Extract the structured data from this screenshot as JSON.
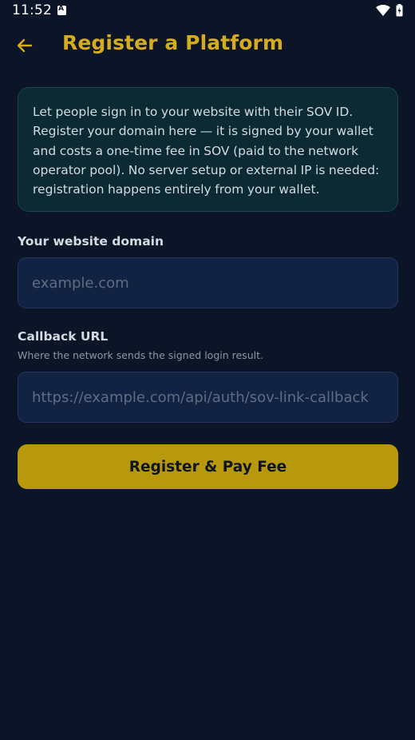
{
  "status_bar": {
    "time": "11:52",
    "icons": [
      "app-notification-icon",
      "wifi-icon",
      "battery-icon"
    ]
  },
  "header": {
    "back_icon": "arrow-left-icon",
    "title": "Register a Platform"
  },
  "info_card": {
    "text": "Let people sign in to your website with their SOV ID. Register your domain here — it is signed by your wallet and costs a one-time fee in SOV (paid to the network operator pool). No server setup or external IP is needed: registration happens entirely from your wallet."
  },
  "form": {
    "domain": {
      "label": "Your website domain",
      "placeholder": "example.com",
      "value": ""
    },
    "callback": {
      "label": "Callback URL",
      "hint": "Where the network sends the signed login result.",
      "placeholder": "https://example.com/api/auth/sov-link-callback",
      "value": ""
    },
    "submit_label": "Register & Pay Fee"
  },
  "colors": {
    "background": "#0c1427",
    "accent": "#d5ac1e",
    "button": "#b8980c",
    "card": "#0c2a33",
    "input": "#112243"
  }
}
